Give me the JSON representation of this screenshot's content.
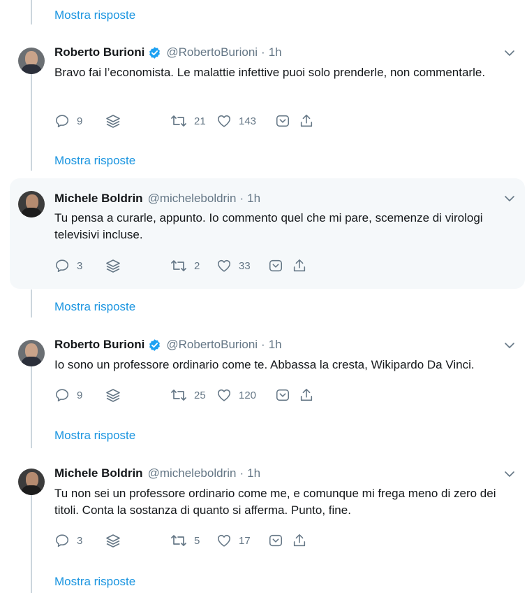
{
  "show_replies_label": "Mostra risposte",
  "tweets": [
    {
      "name": "Roberto Burioni",
      "verified": true,
      "handle": "@RobertoBurioni",
      "time": "1h",
      "text": "Bravo fai l’economista. Le malattie infettive puoi solo prenderle, non commentarle.",
      "replies": "9",
      "retweets": "21",
      "likes": "143"
    },
    {
      "name": "Michele Boldrin",
      "verified": false,
      "handle": "@micheleboldrin",
      "time": "1h",
      "text": "Tu pensa a curarle, appunto. Io commento quel che mi pare, scemenze di virologi televisivi incluse.",
      "replies": "3",
      "retweets": "2",
      "likes": "33"
    },
    {
      "name": "Roberto Burioni",
      "verified": true,
      "handle": "@RobertoBurioni",
      "time": "1h",
      "text": "Io sono un professore ordinario come te. Abbassa la cresta, Wikipardo Da Vinci.",
      "replies": "9",
      "retweets": "25",
      "likes": "120"
    },
    {
      "name": "Michele Boldrin",
      "verified": false,
      "handle": "@micheleboldrin",
      "time": "1h",
      "text": "Tu non sei un professore ordinario come me, e comunque mi frega meno di zero dei titoli. Conta la sostanza di quanto si afferma. Punto, fine.",
      "replies": "3",
      "retweets": "5",
      "likes": "17"
    }
  ],
  "colors": {
    "link": "#1b95e0",
    "verified": "#1da1f2",
    "muted": "#657786",
    "thread_line": "#ccd6dd",
    "highlight_bg": "#f5f8fa"
  }
}
